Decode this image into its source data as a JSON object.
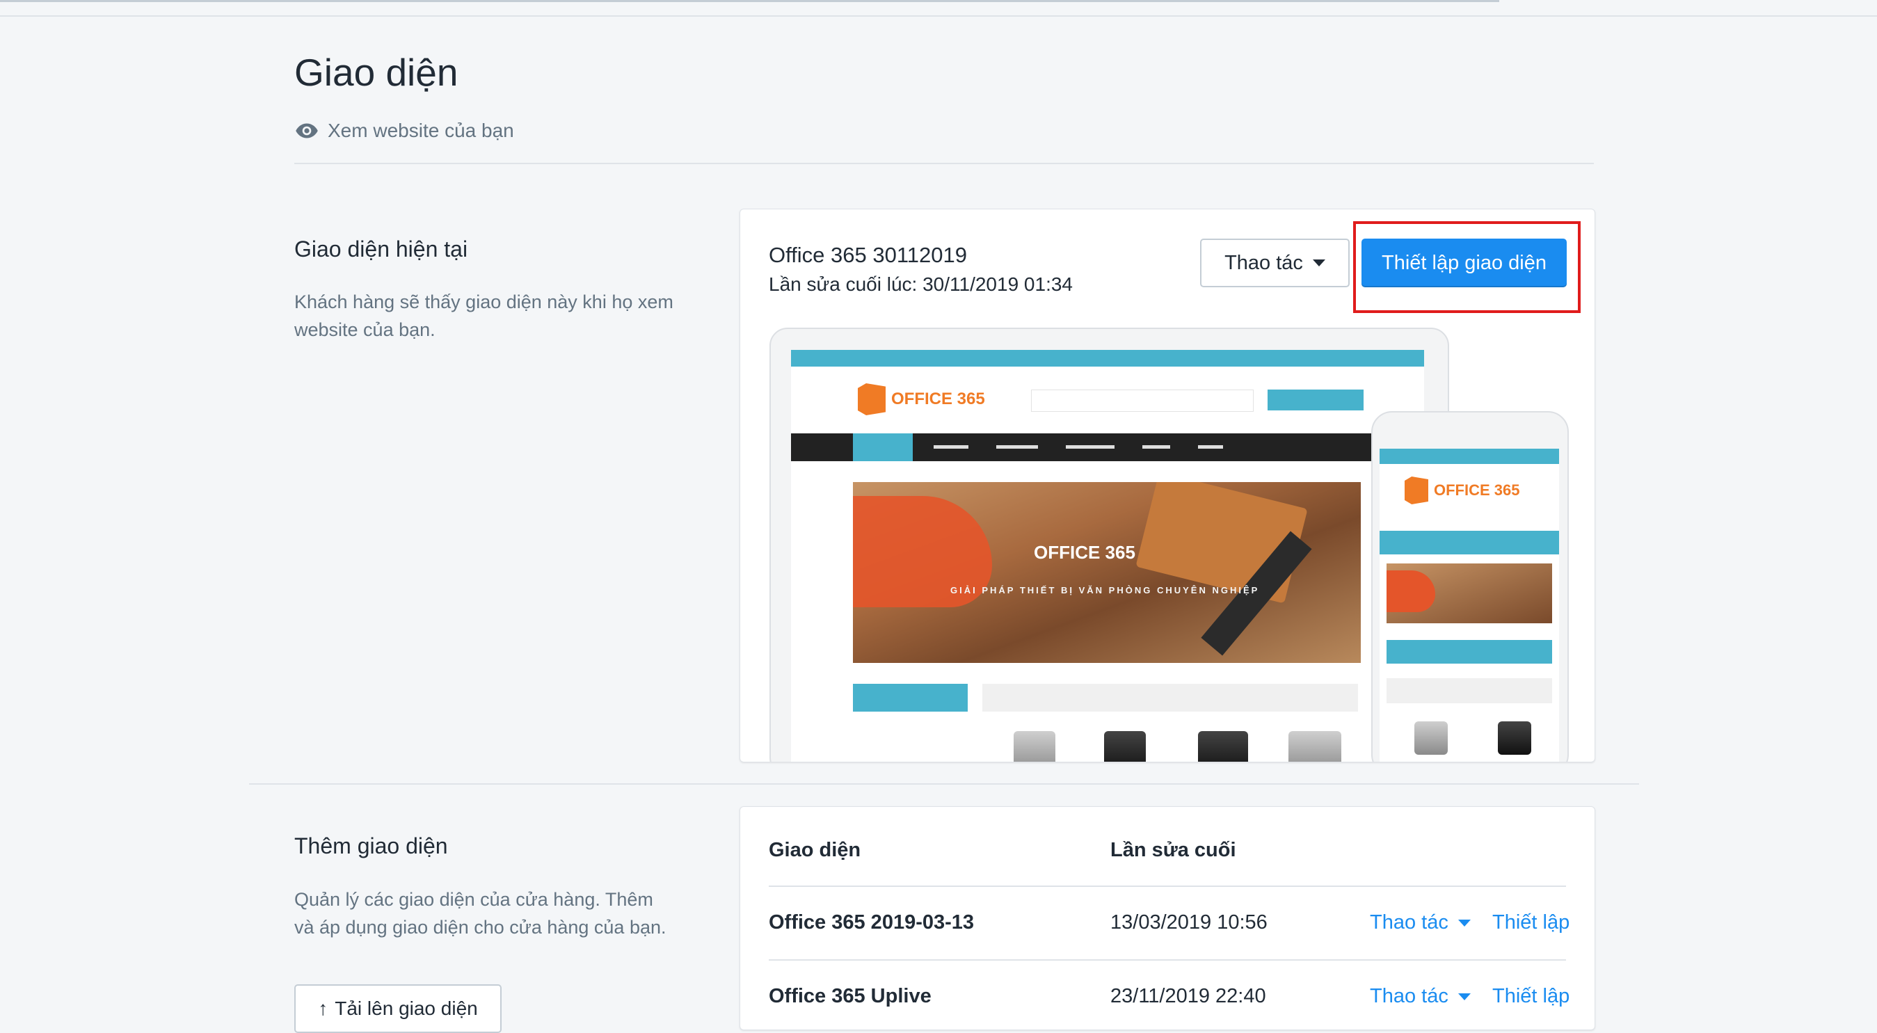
{
  "page": {
    "title": "Giao diện",
    "view_website": "Xem website của bạn"
  },
  "current_section": {
    "title": "Giao diện hiện tại",
    "description": "Khách hàng sẽ thấy giao diện này khi họ xem website của bạn.",
    "theme_name": "Office 365 30112019",
    "last_edited": "Lần sửa cuối lúc: 30/11/2019 01:34",
    "actions_label": "Thao tác",
    "customize_label": "Thiết lập giao diện",
    "preview": {
      "logo_text": "OFFICE 365",
      "banner_title": "OFFICE 365",
      "banner_subtitle": "GIẢI PHÁP THIẾT BỊ VĂN PHÒNG CHUYÊN NGHIỆP"
    }
  },
  "add_section": {
    "title": "Thêm giao diện",
    "description": "Quản lý các giao diện của cửa hàng. Thêm và áp dụng giao diện cho cửa hàng của bạn.",
    "upload_label": "Tải lên giao diện",
    "columns": [
      "Giao diện",
      "Lần sửa cuối"
    ],
    "rows": [
      {
        "name": "Office 365 2019-03-13",
        "date": "13/03/2019 10:56",
        "actions": "Thao tác",
        "customize": "Thiết lập"
      },
      {
        "name": "Office 365 Uplive",
        "date": "23/11/2019 22:40",
        "actions": "Thao tác",
        "customize": "Thiết lập"
      }
    ]
  },
  "colors": {
    "primary": "#1a8cf0",
    "highlight": "#e01c1c",
    "theme_accent": "#47b2cc",
    "logo_orange": "#f07b25"
  },
  "icons": {
    "view": "eye-icon",
    "dropdown": "caret-down-icon",
    "upload": "upload-arrow-icon"
  }
}
